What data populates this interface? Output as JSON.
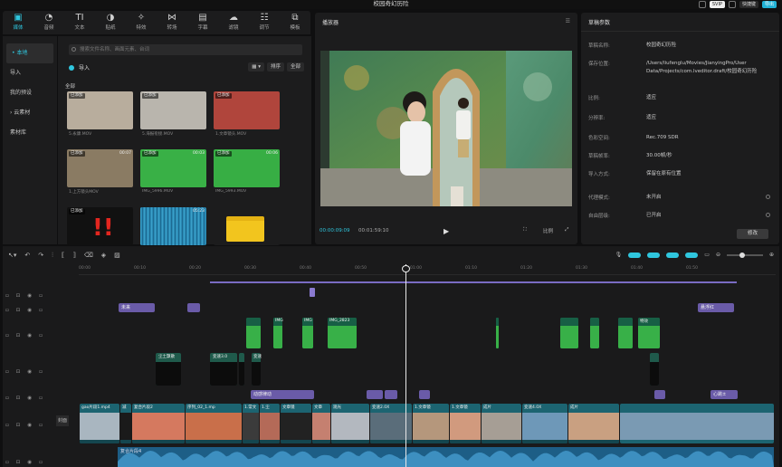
{
  "app": {
    "title": "校园奇幻历险",
    "account_badge": "SVIP",
    "shortcut_button": "快捷键",
    "export_button": "导出"
  },
  "toolbar": [
    {
      "label": "媒体",
      "icon": "media-icon",
      "glyph": "▣",
      "active": true
    },
    {
      "label": "音频",
      "icon": "audio-icon",
      "glyph": "◔"
    },
    {
      "label": "文本",
      "icon": "text-icon",
      "glyph": "TI"
    },
    {
      "label": "贴纸",
      "icon": "sticker-icon",
      "glyph": "◑"
    },
    {
      "label": "特效",
      "icon": "effects-icon",
      "glyph": "✧"
    },
    {
      "label": "转场",
      "icon": "transition-icon",
      "glyph": "⋈"
    },
    {
      "label": "字幕",
      "icon": "subtitle-icon",
      "glyph": "▤"
    },
    {
      "label": "滤镜",
      "icon": "filter-icon",
      "glyph": "☁"
    },
    {
      "label": "调节",
      "icon": "adjust-icon",
      "glyph": "☷"
    },
    {
      "label": "模板",
      "icon": "template-icon",
      "glyph": "⧉"
    }
  ],
  "leftnav": [
    {
      "label": "• 本地",
      "active": true
    },
    {
      "label": "导入"
    },
    {
      "label": "我的预设"
    },
    {
      "label": "› 云素材"
    },
    {
      "label": "素材库"
    }
  ],
  "media": {
    "search_placeholder": "搜索文件名称、画面元素、台词",
    "import_label": "导入",
    "sort_label": "排序",
    "filter_label": "全部",
    "all_label": "全部",
    "added_label": "已添加",
    "items": [
      {
        "name": "5.永康.MOV",
        "duration": "",
        "added": true,
        "color": "#b8ad9d"
      },
      {
        "name": "5.海报衔接.MOV",
        "duration": "",
        "added": true,
        "color": "#b9b5ad"
      },
      {
        "name": "1.文章镜头.MOV",
        "duration": "",
        "added": true,
        "color": "#b0453c"
      },
      {
        "name": "1.上方镜头MOV",
        "duration": "00:07",
        "added": true,
        "color": "#8a7b63"
      },
      {
        "name": "IMG_5996.MOV",
        "duration": "00:03",
        "added": true,
        "color": "#39b046"
      },
      {
        "name": "IMG_5993.MOV",
        "duration": "00:06",
        "added": true,
        "color": "#37ae44"
      },
      {
        "name": "",
        "duration": "",
        "added": true,
        "color": "#111111"
      },
      {
        "name": "",
        "duration": "05:23",
        "added": false,
        "color": "#2a89b4"
      },
      {
        "name": "",
        "duration": "",
        "added": false,
        "color": "#f1c21b"
      }
    ]
  },
  "player": {
    "title": "播放器",
    "current_time": "00:00:09:09",
    "total_time": "00:01:59:10",
    "ratio_label": "比例"
  },
  "draft": {
    "title": "草稿参数",
    "modify_button": "修改",
    "rows": [
      {
        "key": "草稿名称:",
        "value": "校园奇幻历险"
      },
      {
        "key": "保存位置:",
        "value": "/Users/liufenglu/Movies/JianyingPro/User Data/Projects/com.lveditor.draft/校园奇幻历险"
      },
      {
        "key": "比例:",
        "value": "适应"
      },
      {
        "key": "分辨率:",
        "value": "适应"
      },
      {
        "key": "色彩空间:",
        "value": "Rec.709 SDR"
      },
      {
        "key": "草稿帧率:",
        "value": "30.00帧/秒"
      },
      {
        "key": "导入方式:",
        "value": "保留在原有位置"
      },
      {
        "key": "代理模式:",
        "value": "未开启",
        "info": true
      },
      {
        "key": "自由层级:",
        "value": "已开启",
        "info": true
      }
    ]
  },
  "timeline": {
    "ruler": [
      "00:00",
      "00:10",
      "00:20",
      "00:30",
      "00:40",
      "00:50",
      "01:00",
      "01:10",
      "01:20",
      "01:30",
      "01:40",
      "01:50"
    ],
    "cover_label": "封面",
    "text_clips": [
      {
        "label": "未来",
        "row": 0
      },
      {
        "label": "",
        "row": 0
      },
      {
        "label": "悬浮红",
        "row": 0
      },
      {
        "label": "动感律动",
        "row": 1
      },
      {
        "label": "",
        "row": 1
      },
      {
        "label": "",
        "row": 1
      },
      {
        "label": "",
        "row": 1
      },
      {
        "label": "心跳±",
        "row": 1
      }
    ],
    "overlay_labels": [
      "IMG",
      "IMG",
      "IMG_2823",
      "特效"
    ],
    "mid_labels": [
      "尘土飘散",
      "变速3.0",
      "变速"
    ],
    "main_labels": [
      "gao片段1.mp4",
      "减",
      "复合片段2",
      "序列_02_1.mp",
      "1.常文",
      "1.尘",
      "文章镜",
      "文章",
      "观光",
      "变速2.0X",
      "1.文章镜",
      "1.文章镜",
      "成片",
      "变速4.0X",
      "成片"
    ],
    "audio_label": "复合片段4"
  }
}
